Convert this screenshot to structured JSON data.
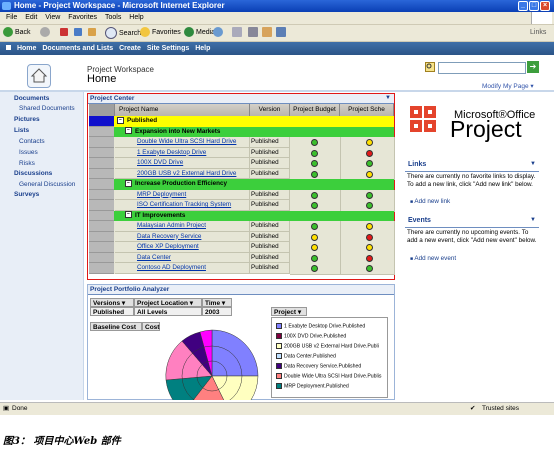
{
  "window": {
    "title": "Home - Project Workspace - Microsoft Internet Explorer",
    "min": "_",
    "max": "□",
    "close": "×"
  },
  "menu": [
    "File",
    "Edit",
    "View",
    "Favorites",
    "Tools",
    "Help"
  ],
  "toolbar": {
    "back": "Back",
    "search": "Search",
    "favorites": "Favorites",
    "media": "Media",
    "links": "Links"
  },
  "spnav": {
    "items": [
      "Home",
      "Documents and Lists",
      "Create",
      "Site Settings",
      "Help"
    ]
  },
  "header": {
    "site": "Project Workspace",
    "page": "Home",
    "modify": "Modify My Page ▾"
  },
  "leftnav": {
    "documents": "Documents",
    "shared_documents": "Shared Documents",
    "pictures": "Pictures",
    "lists": "Lists",
    "contacts": "Contacts",
    "issues": "Issues",
    "risks": "Risks",
    "discussions": "Discussions",
    "general_discussion": "General Discussion",
    "surveys": "Surveys"
  },
  "project_center": {
    "title": "Project Center",
    "columns": {
      "name": "Project Name",
      "version": "Version",
      "budget": "Project Budget",
      "schedule": "Project Sche"
    },
    "rows": [
      {
        "kind": "top",
        "name": "Published"
      },
      {
        "kind": "grp",
        "name": "Expansion into New Markets"
      },
      {
        "kind": "task",
        "name": "Double Wide Ultra SCSI Hard Drive",
        "version": "Published",
        "budget": "#3bbf2c",
        "schedule": "#ffe000"
      },
      {
        "kind": "task",
        "name": "1 Exabyte Desktop Drive",
        "version": "Published",
        "budget": "#3bbf2c",
        "schedule": "#e21a1a"
      },
      {
        "kind": "task",
        "name": "100X DVD Drive",
        "version": "Published",
        "budget": "#3bbf2c",
        "schedule": "#3bbf2c"
      },
      {
        "kind": "task",
        "name": "200GB USB v2 External Hard Drive",
        "version": "Published",
        "budget": "#3bbf2c",
        "schedule": "#ffe000"
      },
      {
        "kind": "grp",
        "name": "Increase Production Efficiency"
      },
      {
        "kind": "task",
        "name": "MRP Deployment",
        "version": "Published",
        "budget": "#3bbf2c",
        "schedule": "#3bbf2c"
      },
      {
        "kind": "task",
        "name": "ISO Certification Tracking System",
        "version": "Published",
        "budget": "#3bbf2c",
        "schedule": "#3bbf2c"
      },
      {
        "kind": "grp",
        "name": "IT Improvements"
      },
      {
        "kind": "task",
        "name": "Malaysian Admin Project",
        "version": "Published",
        "budget": "#3bbf2c",
        "schedule": "#ffe000"
      },
      {
        "kind": "task",
        "name": "Data Recovery Service",
        "version": "Published",
        "budget": "#ffe000",
        "schedule": "#e21a1a"
      },
      {
        "kind": "task",
        "name": "Office XP Deployment",
        "version": "Published",
        "budget": "#ffe000",
        "schedule": "#ffe000"
      },
      {
        "kind": "task",
        "name": "Data Center",
        "version": "Published",
        "budget": "#3bbf2c",
        "schedule": "#e21a1a"
      },
      {
        "kind": "task",
        "name": "Contoso AD Deployment",
        "version": "Published",
        "budget": "#3bbf2c",
        "schedule": "#3bbf2c"
      }
    ]
  },
  "portfolio": {
    "title": "Project Portfolio Analyzer",
    "versions": "Versions ▾",
    "project_location": "Project Location ▾",
    "time": "Time ▾",
    "published": "Published",
    "all_levels": "All Levels",
    "year": "2003",
    "baseline_cost": "Baseline Cost",
    "cost": "Cost",
    "project_dd": "Project ▾",
    "legend": [
      {
        "label": "1 Exabyte Desktop Drive.Published",
        "color": "#8080ff"
      },
      {
        "label": "100X DVD Drive.Published",
        "color": "#800040"
      },
      {
        "label": "200GB USB v2 External Hard Drive.Publi",
        "color": "#ffffc0"
      },
      {
        "label": "Data Center.Published",
        "color": "#c0e0ff"
      },
      {
        "label": "Data Recovery Service.Published",
        "color": "#400080"
      },
      {
        "label": "Double Wide Ultra SCSI Hard Drive.Publis",
        "color": "#ff8080"
      },
      {
        "label": "MRP Deployment.Published",
        "color": "#008080"
      }
    ]
  },
  "right": {
    "ms": "Microsoft®Office",
    "project": "Project",
    "links_title": "Links",
    "links_text": "There are currently no favorite links to display. To add a new link, click \"Add new link\" below.",
    "add_link": "Add new link",
    "events_title": "Events",
    "events_text": "There are currently no upcoming events. To add a new event, click \"Add new event\" below.",
    "add_event": "Add new event"
  },
  "status": {
    "done": "Done",
    "zone": "Trusted sites"
  },
  "caption": "图3： 项目中心Web 部件"
}
